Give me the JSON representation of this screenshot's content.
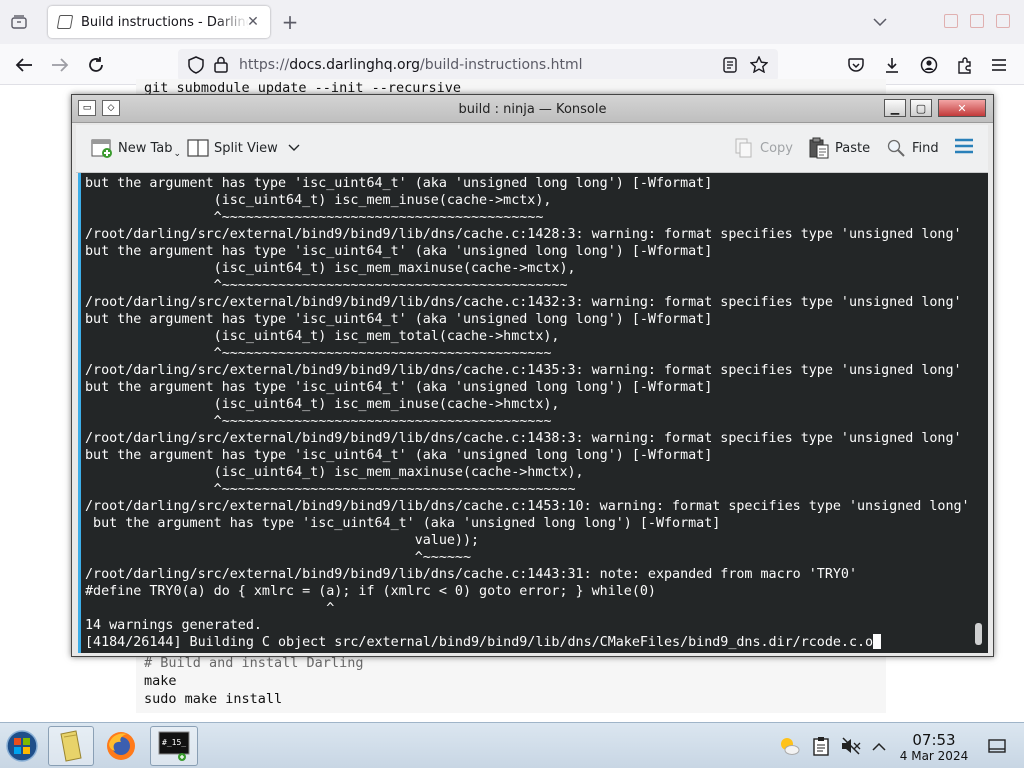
{
  "browser": {
    "tab_title": "Build instructions - Darling",
    "url_host": "docs.darlinghq.org",
    "url_prefix": "https://",
    "url_path": "/build-instructions.html"
  },
  "page": {
    "code_top": "git submodule update --init --recursive",
    "code_bottom": {
      "comment": "# Build and install Darling",
      "line1": "make",
      "line2": "sudo make install"
    }
  },
  "konsole": {
    "title": "build : ninja — Konsole",
    "toolbar": {
      "new_tab": "New Tab",
      "split_view": "Split View",
      "copy": "Copy",
      "paste": "Paste",
      "find": "Find"
    },
    "lines": [
      "but the argument has type 'isc_uint64_t' (aka 'unsigned long long') [-Wformat]",
      "                (isc_uint64_t) isc_mem_inuse(cache->mctx),",
      "                ^~~~~~~~~~~~~~~~~~~~~~~~~~~~~~~~~~~~~~~~~",
      "/root/darling/src/external/bind9/bind9/lib/dns/cache.c:1428:3: warning: format specifies type 'unsigned long'",
      "but the argument has type 'isc_uint64_t' (aka 'unsigned long long') [-Wformat]",
      "                (isc_uint64_t) isc_mem_maxinuse(cache->mctx),",
      "                ^~~~~~~~~~~~~~~~~~~~~~~~~~~~~~~~~~~~~~~~~~~~",
      "/root/darling/src/external/bind9/bind9/lib/dns/cache.c:1432:3: warning: format specifies type 'unsigned long'",
      "but the argument has type 'isc_uint64_t' (aka 'unsigned long long') [-Wformat]",
      "                (isc_uint64_t) isc_mem_total(cache->hmctx),",
      "                ^~~~~~~~~~~~~~~~~~~~~~~~~~~~~~~~~~~~~~~~~~",
      "/root/darling/src/external/bind9/bind9/lib/dns/cache.c:1435:3: warning: format specifies type 'unsigned long'",
      "but the argument has type 'isc_uint64_t' (aka 'unsigned long long') [-Wformat]",
      "                (isc_uint64_t) isc_mem_inuse(cache->hmctx),",
      "                ^~~~~~~~~~~~~~~~~~~~~~~~~~~~~~~~~~~~~~~~~~",
      "/root/darling/src/external/bind9/bind9/lib/dns/cache.c:1438:3: warning: format specifies type 'unsigned long'",
      "but the argument has type 'isc_uint64_t' (aka 'unsigned long long') [-Wformat]",
      "                (isc_uint64_t) isc_mem_maxinuse(cache->hmctx),",
      "                ^~~~~~~~~~~~~~~~~~~~~~~~~~~~~~~~~~~~~~~~~~~~~",
      "/root/darling/src/external/bind9/bind9/lib/dns/cache.c:1453:10: warning: format specifies type 'unsigned long'",
      " but the argument has type 'isc_uint64_t' (aka 'unsigned long long') [-Wformat]",
      "                                         value));",
      "                                         ^~~~~~~",
      "/root/darling/src/external/bind9/bind9/lib/dns/cache.c:1443:31: note: expanded from macro 'TRY0'",
      "#define TRY0(a) do { xmlrc = (a); if (xmlrc < 0) goto error; } while(0)",
      "                              ^",
      "14 warnings generated."
    ],
    "prompt_line": "[4184/26144] Building C object src/external/bind9/bind9/lib/dns/CMakeFiles/bind9_dns.dir/rcode.c.o"
  },
  "taskbar": {
    "time": "07:53",
    "date": "4 Mar 2024"
  },
  "icons": {
    "tab_overview": "tab-overview-icon",
    "new_tab": "plus-icon",
    "back": "back-arrow-icon",
    "forward": "forward-arrow-icon",
    "reload": "reload-icon"
  },
  "colors": {
    "terminal_bg": "#232627",
    "terminal_fg": "#fcfcfc",
    "konsole_accent": "#3daee9"
  }
}
